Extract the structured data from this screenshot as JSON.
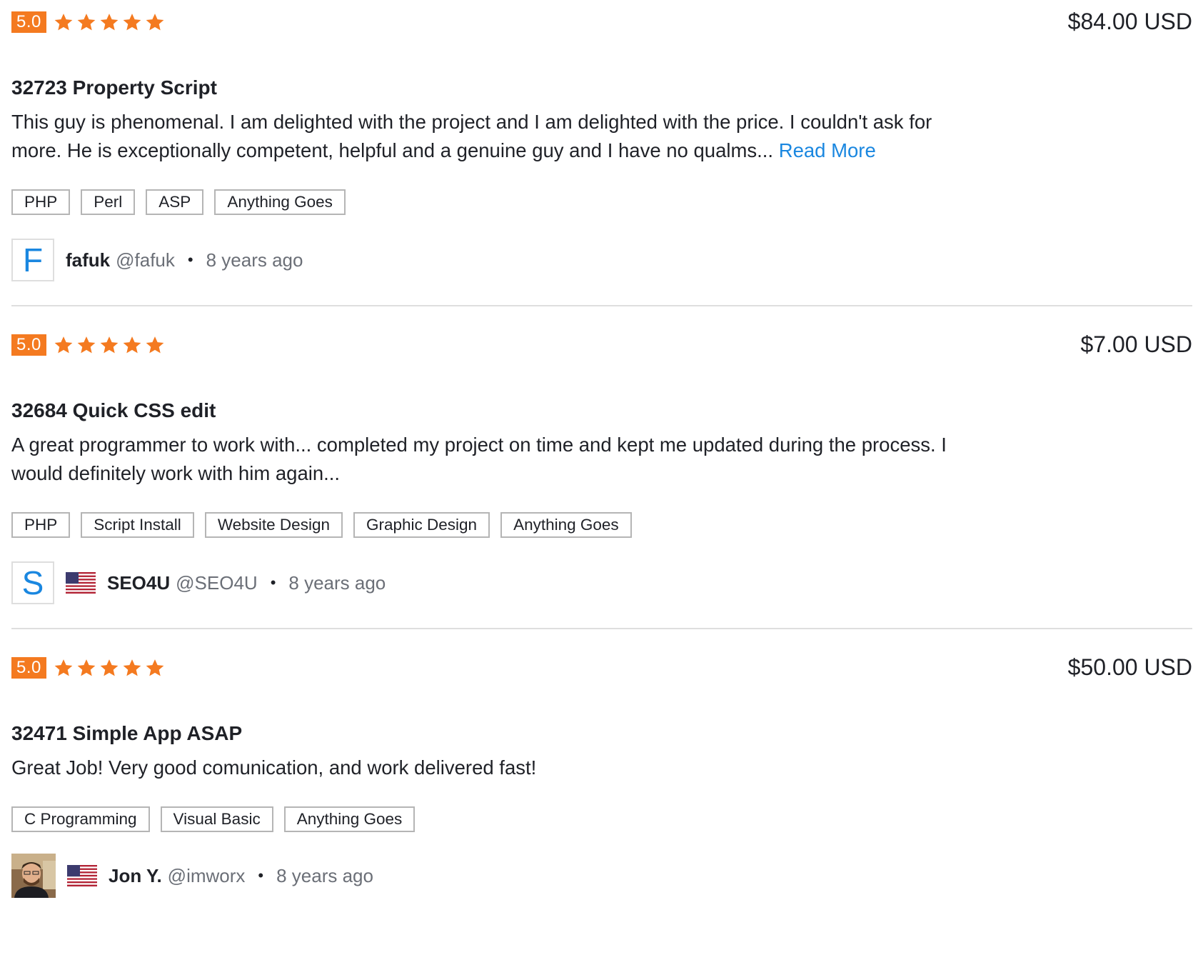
{
  "reviews": [
    {
      "rating": "5.0",
      "stars": 5,
      "price": "$84.00 USD",
      "title": "32723 Property Script",
      "text": "This guy is phenomenal. I am delighted with the project and I am delighted with the price. I couldn't ask for more. He is exceptionally competent, helpful and a genuine guy and I have no qualms...",
      "read_more": "Read More",
      "tags": [
        "PHP",
        "Perl",
        "ASP",
        "Anything Goes"
      ],
      "author": {
        "avatar_letter": "F",
        "name": "fafuk",
        "handle": "@fafuk",
        "country_flag": "none",
        "time": "8 years ago"
      }
    },
    {
      "rating": "5.0",
      "stars": 5,
      "price": "$7.00 USD",
      "title": "32684 Quick CSS edit",
      "text": "A great programmer to work with... completed my project on time and kept me updated during the process. I would definitely work with him again...",
      "tags": [
        "PHP",
        "Script Install",
        "Website Design",
        "Graphic Design",
        "Anything Goes"
      ],
      "author": {
        "avatar_letter": "S",
        "name": "SEO4U",
        "handle": "@SEO4U",
        "country_flag": "us-flag",
        "time": "8 years ago"
      }
    },
    {
      "rating": "5.0",
      "stars": 5,
      "price": "$50.00 USD",
      "title": "32471 Simple App ASAP",
      "text": "Great Job! Very good comunication, and work delivered fast!",
      "tags": [
        "C Programming",
        "Visual Basic",
        "Anything Goes"
      ],
      "author": {
        "avatar_letter": "",
        "name": "Jon Y.",
        "handle": "@imworx",
        "country_flag": "us-flag",
        "time": "8 years ago"
      }
    }
  ],
  "colors": {
    "rating_badge": "#f47a20",
    "star": "#f47a20",
    "link": "#1a87e0",
    "text": "#1f2127",
    "muted": "#6b6f77",
    "tag_border": "#b5b5b5",
    "divider": "#dedede"
  },
  "separator": "•"
}
